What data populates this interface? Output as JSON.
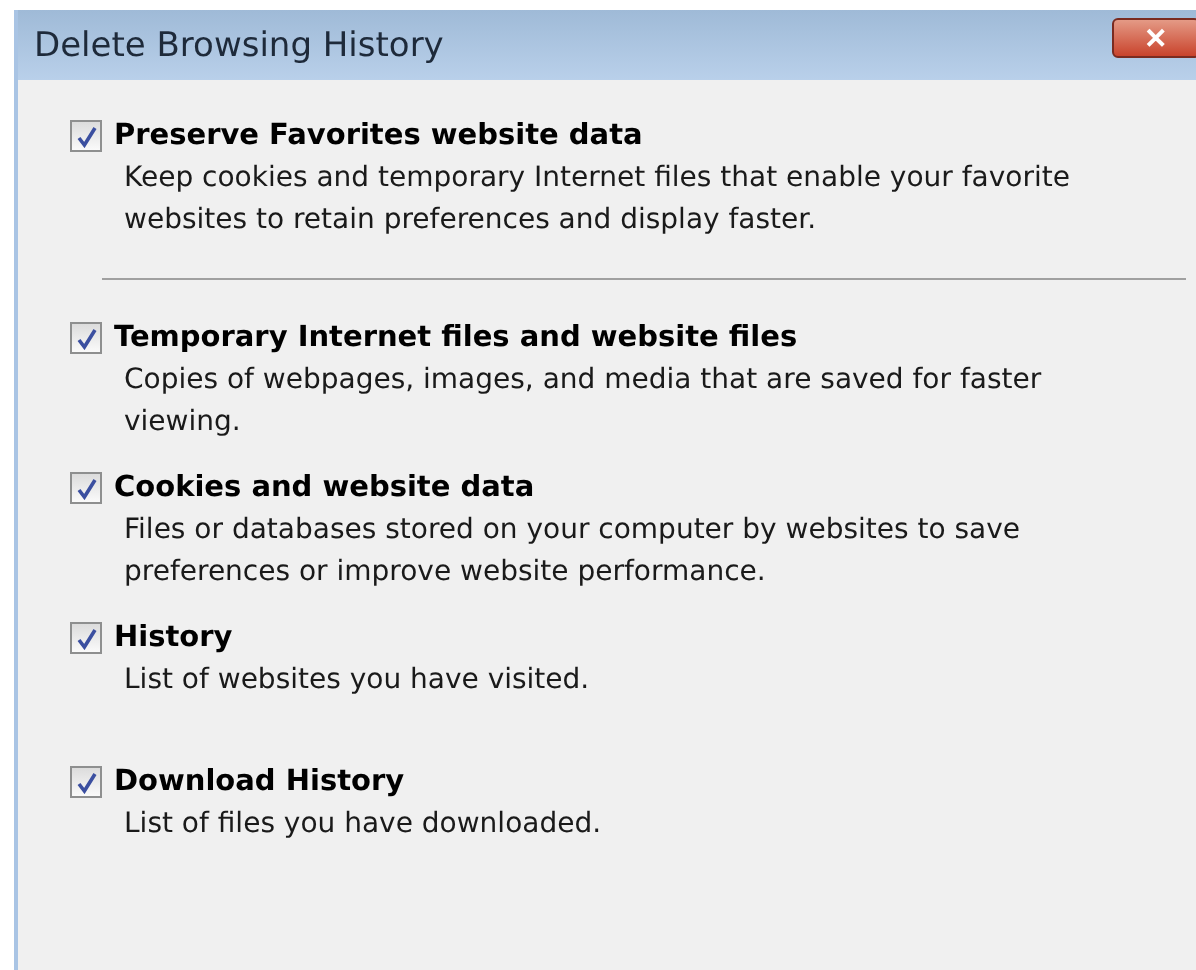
{
  "window": {
    "title": "Delete Browsing History",
    "close": "✕"
  },
  "groups": [
    {
      "options": [
        {
          "label": "Preserve Favorites website data",
          "checked": true,
          "description": "Keep cookies and temporary Internet files that enable your favorite websites to retain preferences and display faster."
        }
      ]
    },
    {
      "options": [
        {
          "label": "Temporary Internet files and website files",
          "checked": true,
          "description": "Copies of webpages, images, and media that are saved for faster viewing."
        },
        {
          "label": "Cookies and website data",
          "checked": true,
          "description": "Files or databases stored on your computer by websites to save preferences or improve website performance."
        },
        {
          "label": "History",
          "checked": true,
          "description": "List of websites you have visited."
        },
        {
          "label": "Download History",
          "checked": true,
          "description": "List of files you have downloaded."
        }
      ]
    }
  ]
}
